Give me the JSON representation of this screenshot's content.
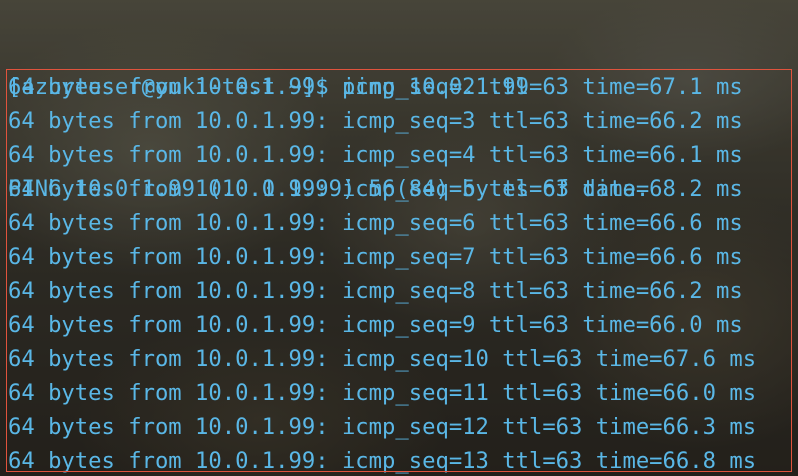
{
  "terminal": {
    "prompt": "[azureuser@yuki-test ~]$ ",
    "command": "ping 10.0.1.99",
    "header": "PING 10.0.1.99 (10.0.1.99) 56(84) bytes of data.",
    "replies": [
      "64 bytes from 10.0.1.99: icmp_seq=2 ttl=63 time=67.1 ms",
      "64 bytes from 10.0.1.99: icmp_seq=3 ttl=63 time=66.2 ms",
      "64 bytes from 10.0.1.99: icmp_seq=4 ttl=63 time=66.1 ms",
      "64 bytes from 10.0.1.99: icmp_seq=5 ttl=63 time=68.2 ms",
      "64 bytes from 10.0.1.99: icmp_seq=6 ttl=63 time=66.6 ms",
      "64 bytes from 10.0.1.99: icmp_seq=7 ttl=63 time=66.6 ms",
      "64 bytes from 10.0.1.99: icmp_seq=8 ttl=63 time=66.2 ms",
      "64 bytes from 10.0.1.99: icmp_seq=9 ttl=63 time=66.0 ms",
      "64 bytes from 10.0.1.99: icmp_seq=10 ttl=63 time=67.6 ms",
      "64 bytes from 10.0.1.99: icmp_seq=11 ttl=63 time=66.0 ms",
      "64 bytes from 10.0.1.99: icmp_seq=12 ttl=63 time=66.3 ms",
      "64 bytes from 10.0.1.99: icmp_seq=13 ttl=63 time=66.8 ms"
    ]
  },
  "colors": {
    "text": "#5ab7e6",
    "highlight_border": "#e0533d"
  }
}
